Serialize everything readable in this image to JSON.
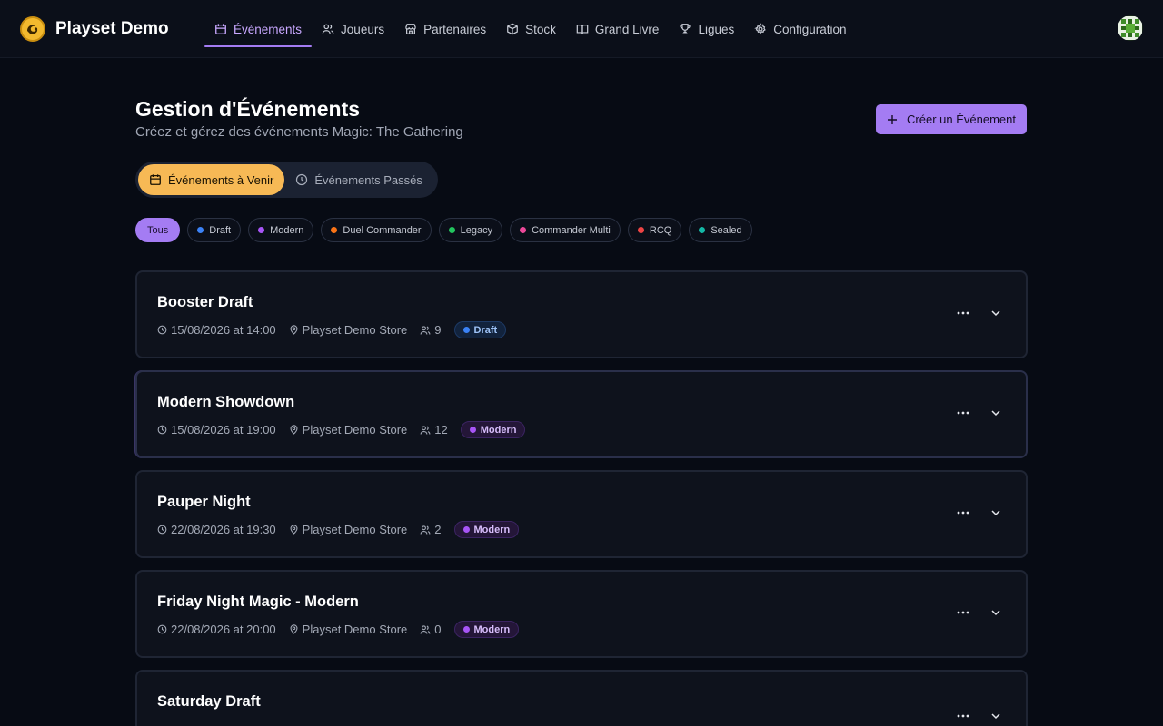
{
  "app": {
    "name": "Playset Demo"
  },
  "nav": [
    {
      "label": "Événements",
      "icon": "calendar-icon",
      "active": true
    },
    {
      "label": "Joueurs",
      "icon": "users-icon"
    },
    {
      "label": "Partenaires",
      "icon": "store-icon"
    },
    {
      "label": "Stock",
      "icon": "box-icon"
    },
    {
      "label": "Grand Livre",
      "icon": "book-icon"
    },
    {
      "label": "Ligues",
      "icon": "trophy-icon"
    },
    {
      "label": "Configuration",
      "icon": "gear-icon"
    }
  ],
  "header": {
    "title": "Gestion d'Événements",
    "subtitle": "Créez et gérez des événements Magic: The Gathering",
    "create_label": "Créer un Événement"
  },
  "tabs": {
    "upcoming": "Événements à Venir",
    "past": "Événements Passés"
  },
  "filters": [
    {
      "label": "Tous",
      "active": true
    },
    {
      "label": "Draft",
      "color": "#3b82f6"
    },
    {
      "label": "Modern",
      "color": "#a855f7"
    },
    {
      "label": "Duel Commander",
      "color": "#f97316"
    },
    {
      "label": "Legacy",
      "color": "#22c55e"
    },
    {
      "label": "Commander Multi",
      "color": "#ec4899"
    },
    {
      "label": "RCQ",
      "color": "#ef4444"
    },
    {
      "label": "Sealed",
      "color": "#14b8a6"
    }
  ],
  "events": [
    {
      "title": "Booster Draft",
      "datetime": "15/08/2026 at 14:00",
      "location": "Playset Demo Store",
      "players": "9",
      "format": "Draft"
    },
    {
      "title": "Modern Showdown",
      "datetime": "15/08/2026 at 19:00",
      "location": "Playset Demo Store",
      "players": "12",
      "format": "Modern"
    },
    {
      "title": "Pauper Night",
      "datetime": "22/08/2026 at 19:30",
      "location": "Playset Demo Store",
      "players": "2",
      "format": "Modern"
    },
    {
      "title": "Friday Night Magic - Modern",
      "datetime": "22/08/2026 at 20:00",
      "location": "Playset Demo Store",
      "players": "0",
      "format": "Modern"
    },
    {
      "title": "Saturday Draft",
      "datetime": "",
      "location": "",
      "players": "",
      "format": ""
    }
  ],
  "colors": {
    "accent": "#a47cf3",
    "tab_active": "#f7b955",
    "draft": "#3b82f6",
    "modern": "#a855f7"
  }
}
